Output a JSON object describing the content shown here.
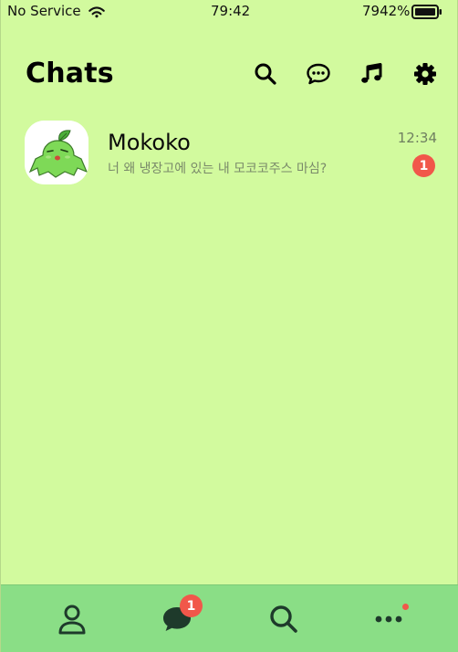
{
  "status_bar": {
    "carrier": "No Service",
    "time": "79:42",
    "battery": "7942%"
  },
  "header": {
    "title": "Chats"
  },
  "chats": [
    {
      "name": "Mokoko",
      "preview": "너 왜 냉장고에 있는 내 모코코주스 마심?",
      "time": "12:34",
      "unread": "1"
    }
  ],
  "bottom_nav": {
    "chats_badge": "1"
  },
  "colors": {
    "background": "#d2fa9e",
    "nav_background": "#8ade86",
    "badge": "#f1574a",
    "icon_dark": "#1e3a2b"
  }
}
